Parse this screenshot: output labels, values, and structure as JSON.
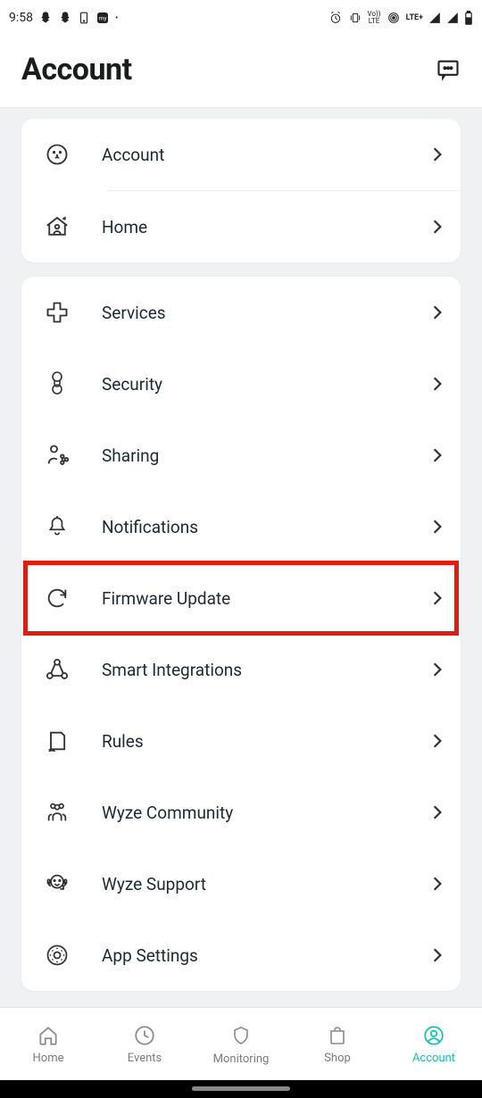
{
  "statusbar": {
    "time": "9:58",
    "lte": "LTE+",
    "volte": "Vo))\nLTE"
  },
  "header": {
    "title": "Account"
  },
  "group1": {
    "items": [
      {
        "label": "Account"
      },
      {
        "label": "Home"
      }
    ]
  },
  "group2": {
    "items": [
      {
        "label": "Services"
      },
      {
        "label": "Security"
      },
      {
        "label": "Sharing"
      },
      {
        "label": "Notifications"
      },
      {
        "label": "Firmware Update"
      },
      {
        "label": "Smart Integrations"
      },
      {
        "label": "Rules"
      },
      {
        "label": "Wyze Community"
      },
      {
        "label": "Wyze Support"
      },
      {
        "label": "App Settings"
      }
    ]
  },
  "nav": {
    "home": "Home",
    "events": "Events",
    "monitoring": "Monitoring",
    "shop": "Shop",
    "account": "Account"
  }
}
